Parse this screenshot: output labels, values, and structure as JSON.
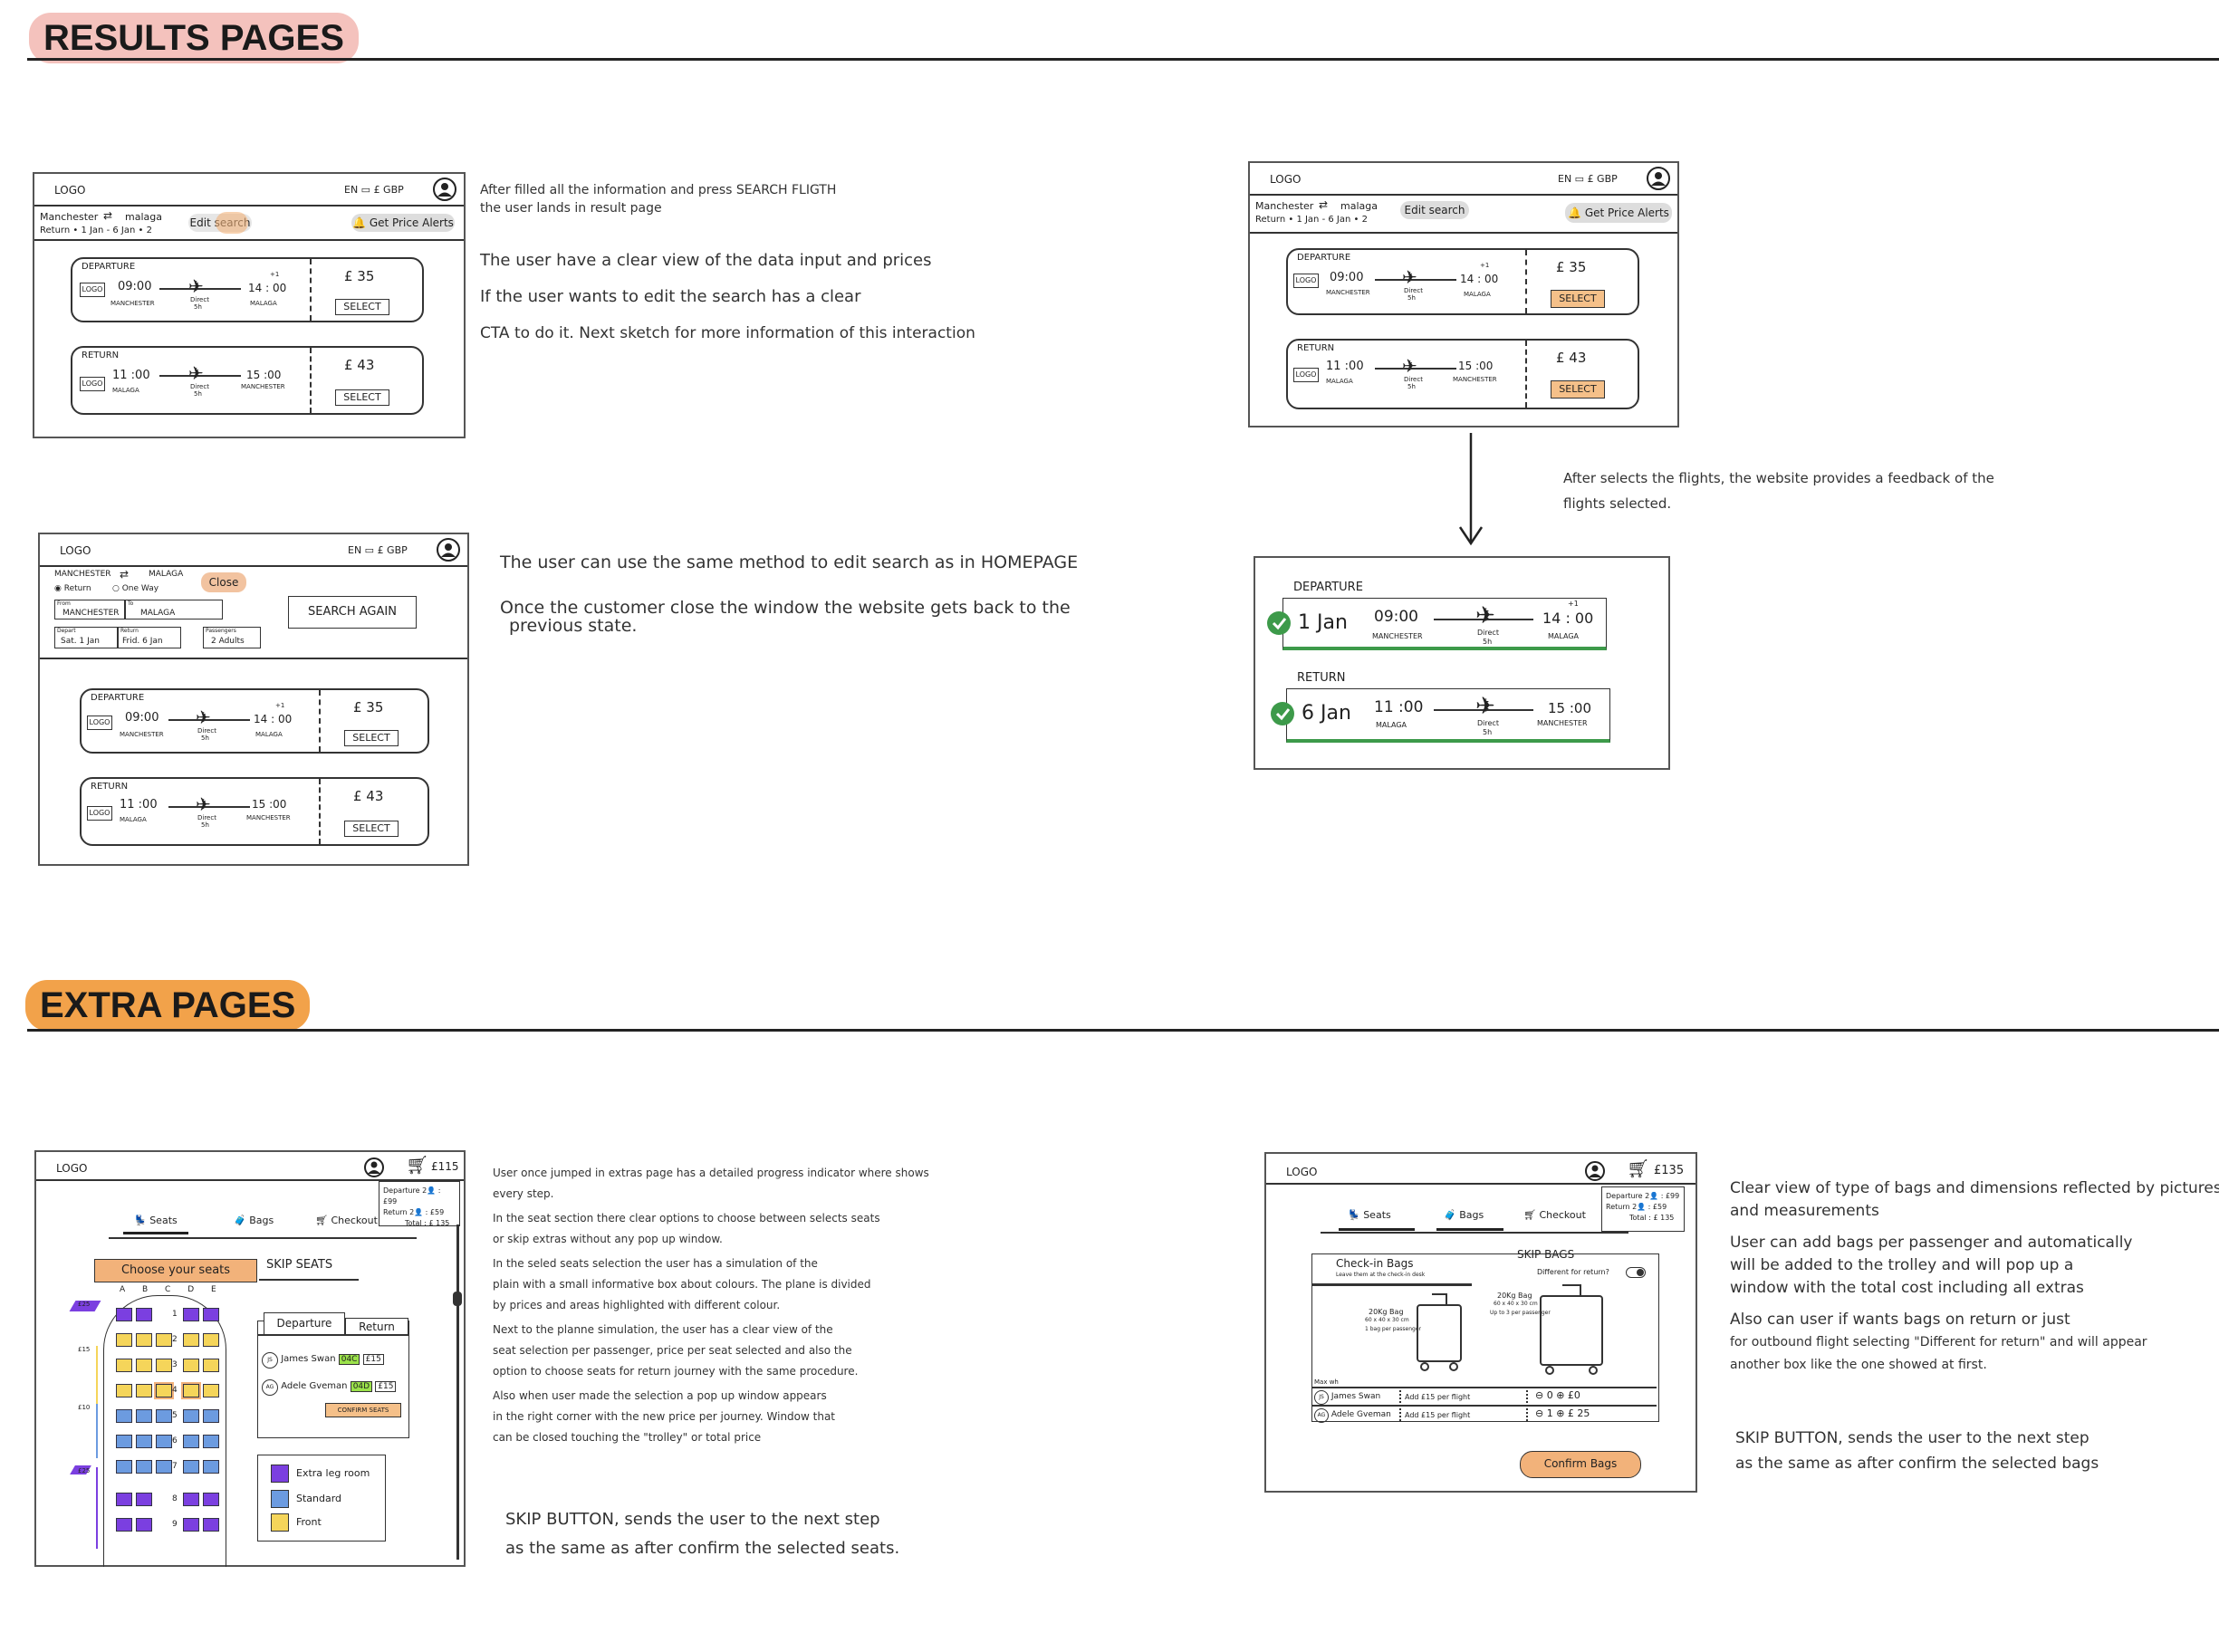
{
  "sections": {
    "results": "RESULTS PAGES",
    "extra": "EXTRA PAGES"
  },
  "colors": {
    "results_pill": "#f4c2bd",
    "extra_pill": "#f2a24a",
    "select_fill": "#f5c089",
    "green": "#3d9a4a",
    "purple": "#7b3fe0",
    "blue": "#6c9be0",
    "yellow": "#f5d55a",
    "highlight_orange": "#f2b27a"
  },
  "common": {
    "logo": "LOGO",
    "lang_currency": "EN ▭ £ GBP",
    "route_from": "Manchester",
    "route_to": "malaga",
    "trip_line": "Return • 1 Jan - 6 Jan • 2",
    "edit_search": "Edit search",
    "price_alerts": "Get Price Alerts",
    "departure": "DEPARTURE",
    "return": "RETURN",
    "logo_small": "LOGO",
    "dep_time": "09:00",
    "dep_arr": "14 : 00",
    "dep_arr_plus": "+1",
    "dep_from": "MANCHESTER",
    "dep_to": "MALAGA",
    "direct": "Direct",
    "duration": "5h",
    "ret_time": "11 :00",
    "ret_arr": "15 :00",
    "ret_from": "MALAGA",
    "ret_to": "MANCHESTER",
    "dep_price": "£ 35",
    "ret_price": "£ 43",
    "select": "SELECT"
  },
  "wire2": {
    "route_from": "MANCHESTER",
    "route_to": "MALAGA",
    "radio_return": "Return",
    "radio_oneway": "One Way",
    "close": "Close",
    "from_label": "From",
    "from_value": "MANCHESTER",
    "to_label": "To",
    "to_value": "MALAGA",
    "depart_label": "Depart",
    "depart_value": "Sat. 1 Jan",
    "return_label": "Return",
    "return_value": "Frid. 6 Jan",
    "pass_label": "Passengers",
    "pass_value": "2 Adults",
    "search_again": "SEARCH AGAIN"
  },
  "feedback": {
    "dep_date": "1 Jan",
    "ret_date": "6 Jan"
  },
  "notes": {
    "n1": [
      "After filled all the information and press SEARCH FLIGTH",
      "the user lands in result page"
    ],
    "n2": [
      "The user have a clear view of the data input and prices",
      "If the user wants to edit the search has a clear",
      "CTA to do it. Next sketch for more information of this interaction"
    ],
    "n3": [
      "The user can use the same method to edit search as in HOMEPAGE",
      "Once the customer close the window the website gets back to the",
      "previous state."
    ],
    "n4": [
      "After selects the flights, the website provides a feedback of the",
      "flights selected."
    ],
    "n5": [
      "User once jumped in extras page has a detailed progress indicator where shows",
      "every step.",
      "In the seat section there clear options to choose between selects seats",
      "or skip extras without any pop up window.",
      "In the seled seats selection the user has a simulation of the",
      "plain with a small informative box about colours. The plane is divided",
      "by prices and areas highlighted with different colour.",
      "Next to the planne simulation, the user has a clear view of the",
      "seat selection per passenger, price per seat selected and also the",
      "option to choose seats for return journey with the same procedure.",
      "Also when user made the selection a pop up window appears",
      "in the right corner with the new price per journey. Window that",
      "can be closed touching the \"trolley\" or total price"
    ],
    "n6": [
      "SKIP BUTTON, sends the user to the next step",
      "as the same as after confirm the selected seats."
    ],
    "n7": [
      "Clear view of type of bags and dimensions reflected by pictures",
      "and measurements",
      "User can add bags per passenger and automatically",
      "will be added to the trolley and will pop up a",
      "window with the total cost including all extras",
      "Also can user if wants bags on return or just",
      "for outbound flight selecting \"Different for return\" and will appear",
      "another box like the one showed at first."
    ],
    "n8": [
      "SKIP BUTTON, sends the user to the next step",
      "as the same as after confirm the selected bags"
    ]
  },
  "seats_page": {
    "logo": "LOGO",
    "total": "£115",
    "popup": [
      "Departure 2👤 : £99",
      "Return 2👤 : £59",
      "Total : £ 135"
    ],
    "tabs": [
      "Seats",
      "Bags",
      "Checkout"
    ],
    "choose": "Choose your seats",
    "skip": "SKIP SEATS",
    "cols": "A B C   D E",
    "rows": [
      "1",
      "2",
      "3",
      "4",
      "5",
      "6",
      "7",
      "8",
      "9"
    ],
    "price_labels": [
      "£25",
      "£15",
      "£10",
      "£25"
    ],
    "tab_dep": "Departure",
    "tab_ret": "Return",
    "pax": [
      {
        "badge": "JS",
        "name": "James Swan",
        "seat": "04C",
        "price": "£15"
      },
      {
        "badge": "AG",
        "name": "Adele Gveman",
        "seat": "04D",
        "price": "£15"
      }
    ],
    "confirm": "CONFIRM SEATS",
    "legend": [
      "Extra leg room",
      "Standard",
      "Front"
    ]
  },
  "bags_page": {
    "logo": "LOGO",
    "total": "£135",
    "popup": [
      "Departure 2👤 : £99",
      "Return 2👤 : £59",
      "Total : £ 135"
    ],
    "tabs": [
      "Seats",
      "Bags",
      "Checkout"
    ],
    "checkin_title": "Check-in Bags",
    "checkin_sub": "Leave them at the check-in desk",
    "skip": "SKIP BAGS",
    "different": "Different for return?",
    "bag1_title": "20Kg Bag",
    "bag1_dims": "60 x 40 x 30 cm",
    "bag1_note": "1 bag per passenger",
    "bag2_title": "20Kg Bag",
    "bag2_dims": "60 x 40 x 30 cm",
    "bag2_note": "Up to 3 per passenger",
    "max": "Max wh",
    "pax": [
      {
        "badge": "JS",
        "name": "James Swan",
        "add": "Add £15 per flight",
        "counter": "⊖ 0 ⊕ £0"
      },
      {
        "badge": "AG",
        "name": "Adele Gveman",
        "add": "Add £15 per flight",
        "counter": "⊖ 1 ⊕ £ 25"
      }
    ],
    "confirm": "Confirm Bags"
  }
}
